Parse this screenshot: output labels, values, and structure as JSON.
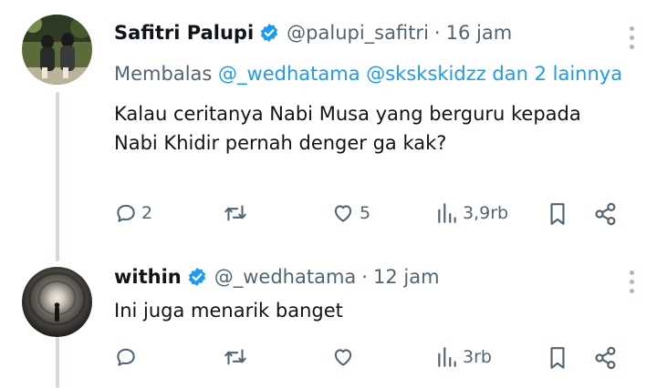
{
  "tweets": [
    {
      "name": "Safitri Palupi",
      "handle": "@palupi_safitri",
      "separator": "·",
      "time": "16 jam",
      "reply_prefix": "Membalas",
      "reply_mentions": "@_wedhatama @sksk­skidzz dan 2 lainnya",
      "text": "Kalau ceritanya Nabi Musa yang berguru kepada Nabi Khidir pernah denger ga kak?",
      "actions": {
        "replies": "2",
        "retweets": "",
        "likes": "5",
        "views": "3,9rb"
      }
    },
    {
      "name": "within",
      "handle": "@_wedhatama",
      "separator": "·",
      "time": "12 jam",
      "text": "Ini juga menarik banget",
      "actions": {
        "replies": "",
        "retweets": "",
        "likes": "",
        "views": "3rb"
      }
    }
  ],
  "icons": {
    "verified": "verified-badge-icon",
    "more": "more-vertical-icon",
    "reply": "reply-bubble-icon",
    "retweet": "retweet-icon",
    "like": "heart-icon",
    "views": "views-bar-chart-icon",
    "bookmark": "bookmark-icon",
    "share": "share-icon"
  },
  "colors": {
    "link": "#1d9bf0",
    "secondary": "#536471",
    "text": "#0f1419",
    "thread_line": "#cfd9de"
  }
}
